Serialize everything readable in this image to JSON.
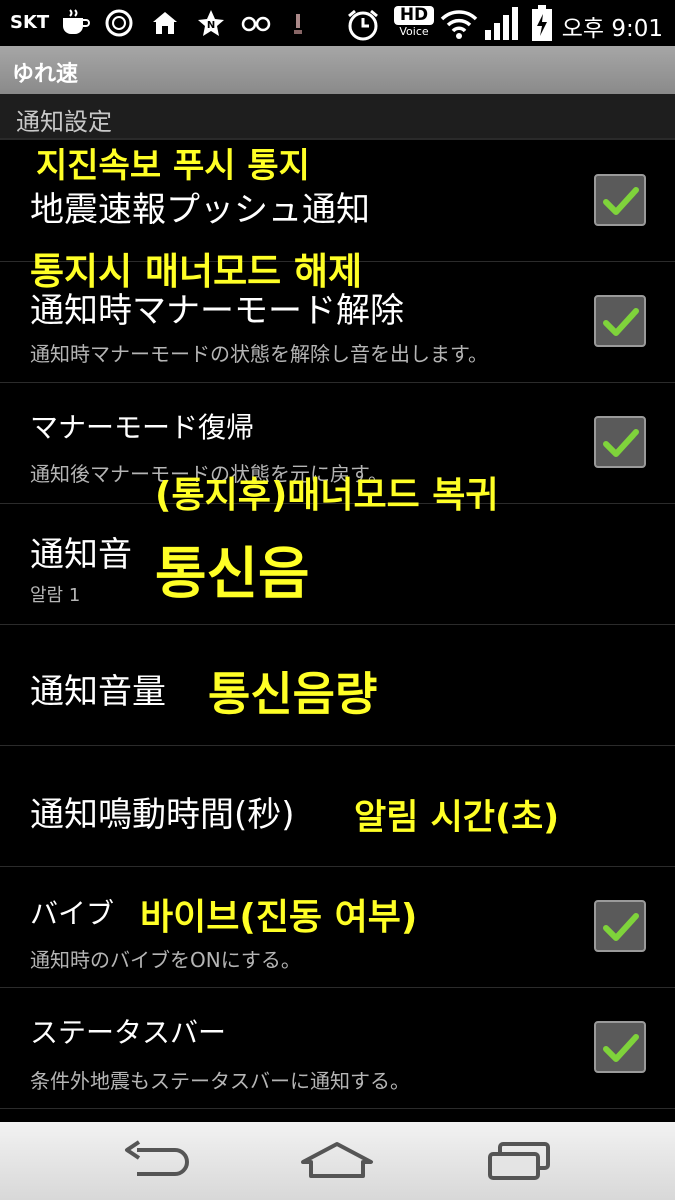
{
  "status_bar": {
    "carrier": "SKT",
    "hd": "HD",
    "voice": "Voice",
    "time": "오후 9:01",
    "icons": [
      "coffee-icon",
      "circle-icon",
      "home-icon",
      "star-icon",
      "glasses-icon",
      "figure-icon",
      "alarm-icon",
      "hd-voice-icon",
      "wifi-icon",
      "signal-icon",
      "battery-icon"
    ]
  },
  "app": {
    "title": "ゆれ速"
  },
  "section_header": "通知設定",
  "preferences": [
    {
      "title": "地震速報プッシュ通知",
      "summary": "",
      "checked": true,
      "annotation": "지진속보 푸시 통지"
    },
    {
      "title": "通知時マナーモード解除",
      "summary": "通知時マナーモードの状態を解除し音を出します。",
      "checked": true,
      "annotation": "통지시 매너모드 해제"
    },
    {
      "title": "マナーモード復帰",
      "summary": "通知後マナーモードの状態を元に戻す。",
      "checked": true,
      "annotation": "(통지후)매너모드 복귀"
    },
    {
      "title": "通知音",
      "summary": "알람 1",
      "annotation": "통신음"
    },
    {
      "title": "通知音量",
      "annotation": "통신음량"
    },
    {
      "title": "通知鳴動時間(秒)",
      "annotation": "알림 시간(초)"
    },
    {
      "title": "バイブ",
      "summary": "通知時のバイブをONにする。",
      "checked": true,
      "annotation": "바이브(진동 여부)"
    },
    {
      "title": "ステータスバー",
      "summary": "条件外地震もステータスバーに通知する。",
      "checked": true,
      "annotation": ""
    }
  ],
  "nav": {
    "icons": [
      "back-icon",
      "home-icon",
      "recent-apps-icon"
    ]
  },
  "colors": {
    "accent_check": "#7fd33b",
    "annotation": "#ffff26",
    "background": "#000000"
  }
}
